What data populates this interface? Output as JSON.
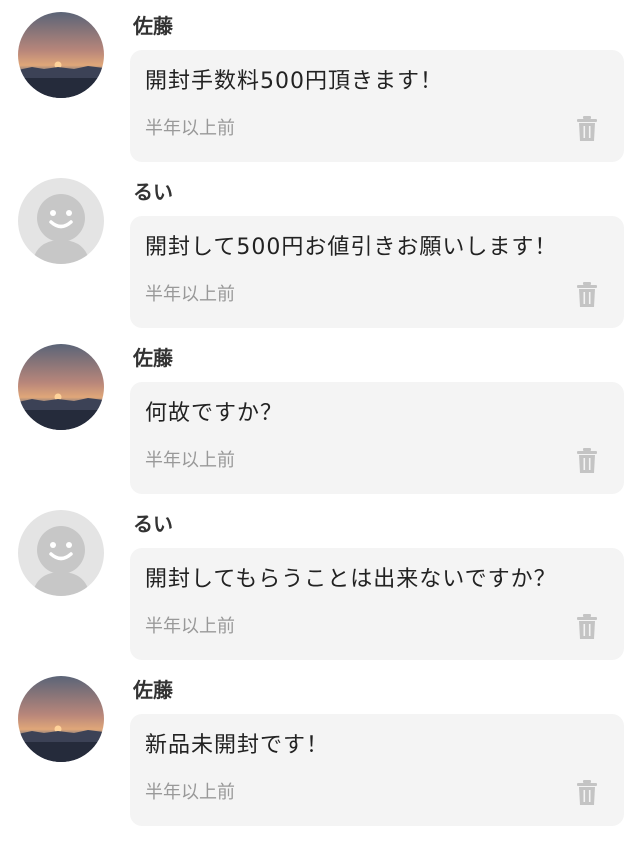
{
  "comments": [
    {
      "user": "佐藤",
      "avatar": "sunset-photo-avatar",
      "text": "開封手数料500円頂きます！",
      "time": "半年以上前",
      "action_icon": "trash-icon"
    },
    {
      "user": "るい",
      "avatar": "default-smiley-avatar",
      "text": "開封して500円お値引きお願いします！",
      "time": "半年以上前",
      "action_icon": "trash-icon"
    },
    {
      "user": "佐藤",
      "avatar": "sunset-photo-avatar",
      "text": "何故ですか？",
      "time": "半年以上前",
      "action_icon": "trash-icon"
    },
    {
      "user": "るい",
      "avatar": "default-smiley-avatar",
      "text": "開封してもらうことは出来ないですか？",
      "time": "半年以上前",
      "action_icon": "trash-icon"
    },
    {
      "user": "佐藤",
      "avatar": "sunset-photo-avatar",
      "text": "新品未開封です！",
      "time": "半年以上前",
      "action_icon": "trash-icon"
    }
  ],
  "colors": {
    "bubble_bg": "#f4f4f4",
    "timestamp": "#999999",
    "icon": "#c4c4c4",
    "default_avatar_bg": "#e4e4e4",
    "default_avatar_fg": "#c7c7c7"
  }
}
